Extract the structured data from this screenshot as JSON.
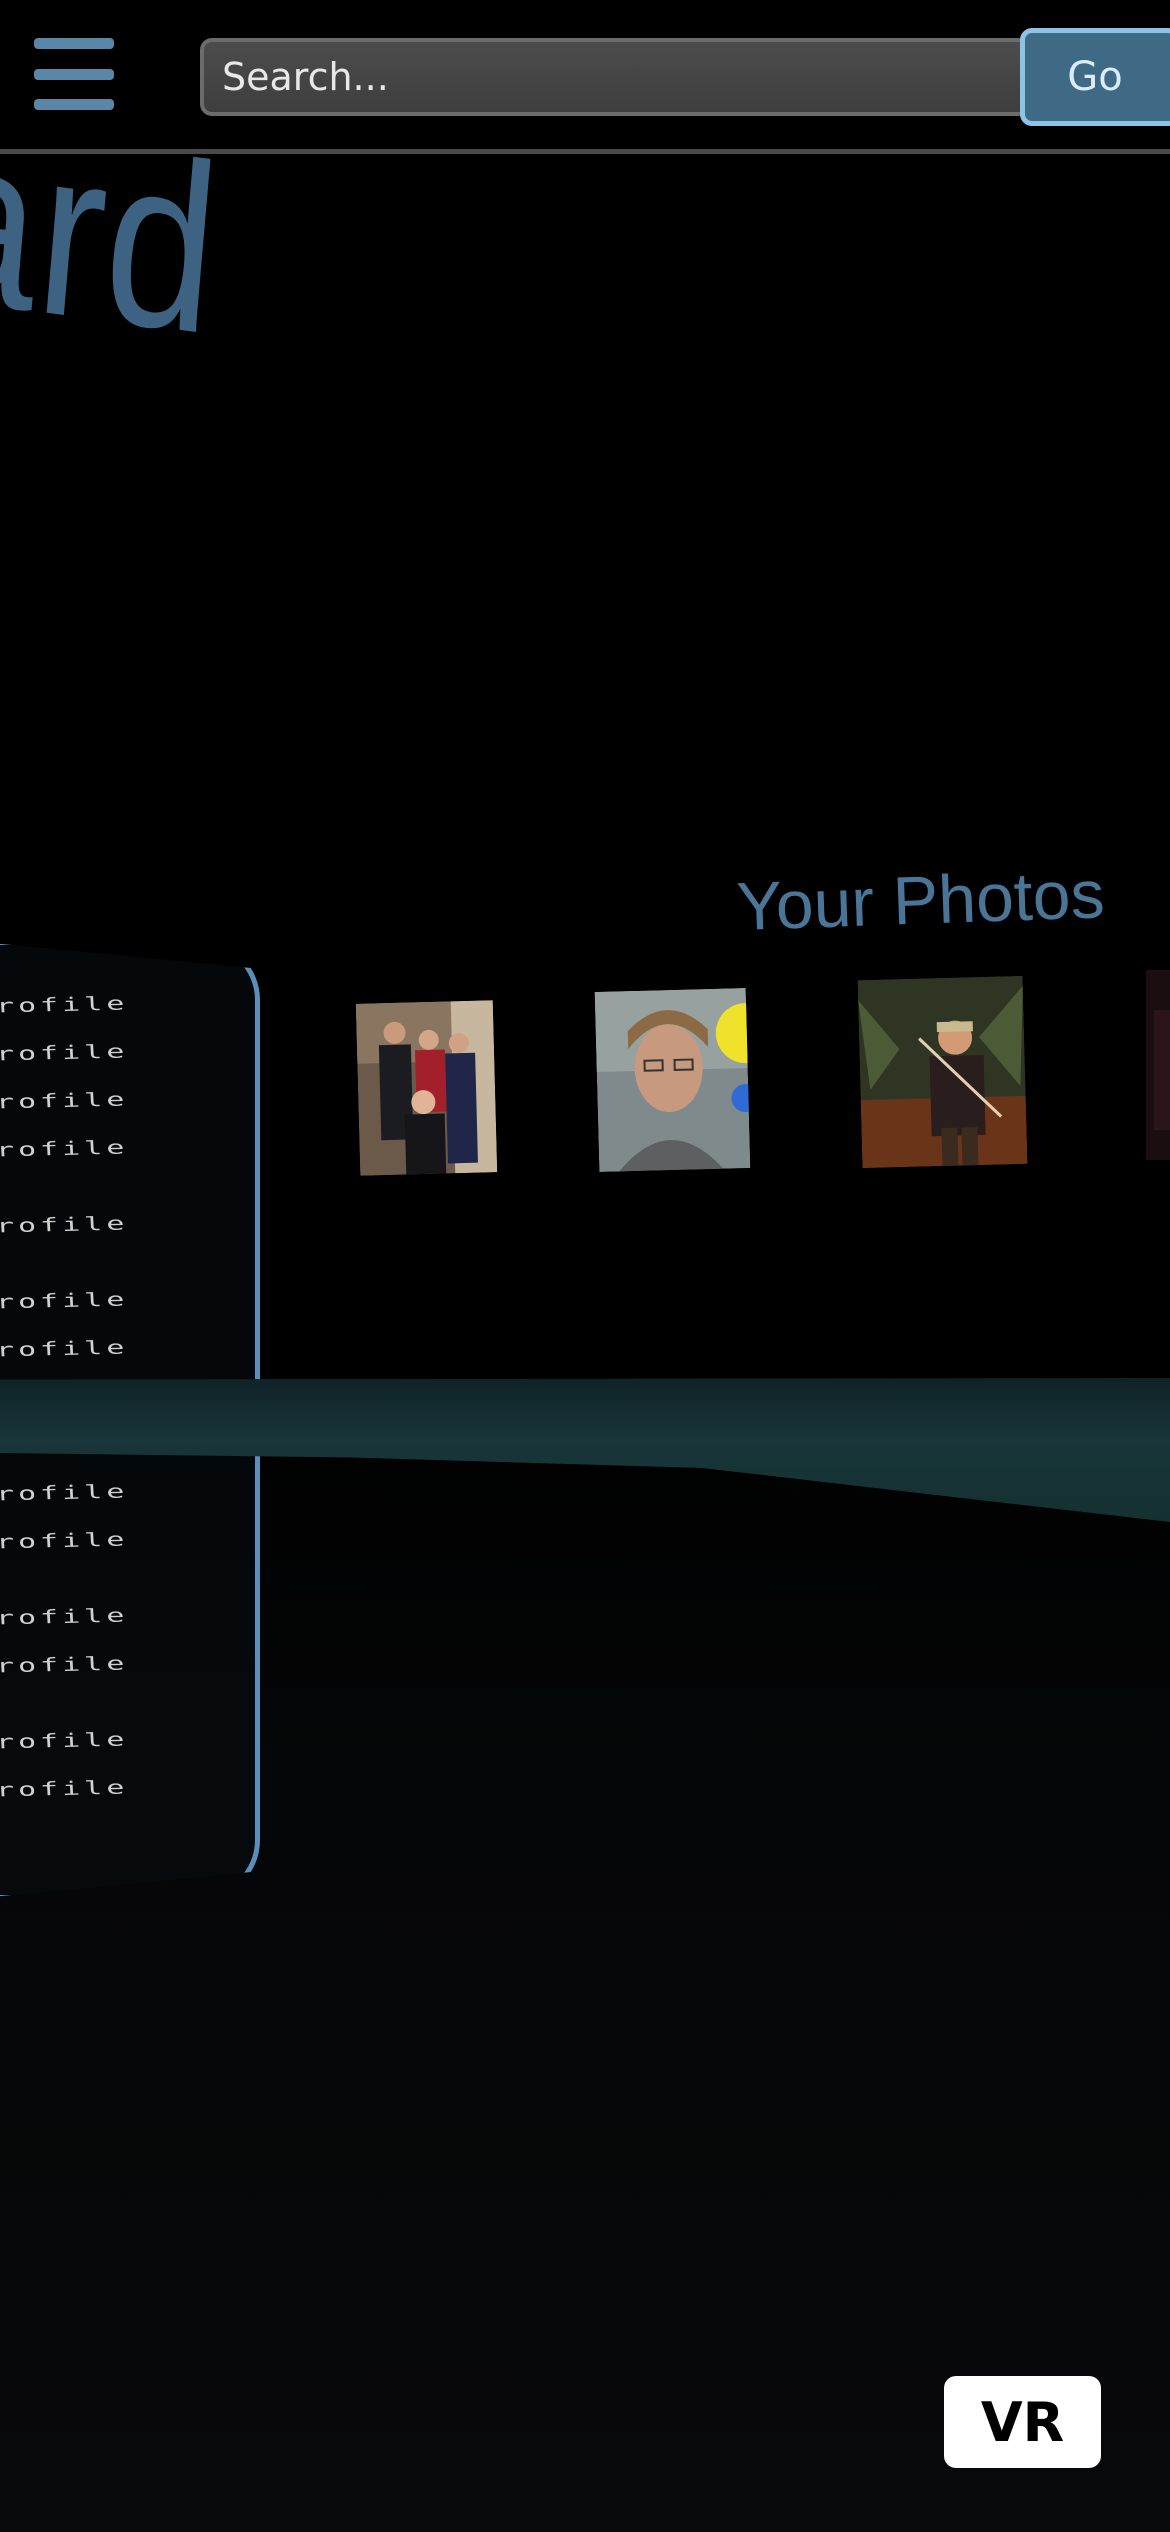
{
  "topbar": {
    "menu_icon": "hamburger-menu-icon",
    "search_placeholder": "Search...",
    "search_value": "",
    "go_label": "Go"
  },
  "scene": {
    "dashboard_title": "ard",
    "photos_heading": "Your Photos",
    "profile_items": [
      "rofile",
      "rofile",
      "rofile",
      "rofile",
      "rofile",
      "rofile",
      "rofile",
      "rofile",
      "rofile",
      "rofile",
      "rofile",
      "rofile",
      "rofile",
      "rofile",
      "rofile"
    ],
    "photos": [
      {
        "name": "photo-group-formal"
      },
      {
        "name": "photo-man-glasses"
      },
      {
        "name": "photo-man-fishing"
      },
      {
        "name": "photo-partial"
      }
    ]
  },
  "vr_button": {
    "label": "VR"
  },
  "colors": {
    "accent": "#5b8fba",
    "title_text": "#3d6282",
    "go_button": "#3e6a86",
    "band": "#18353a"
  }
}
